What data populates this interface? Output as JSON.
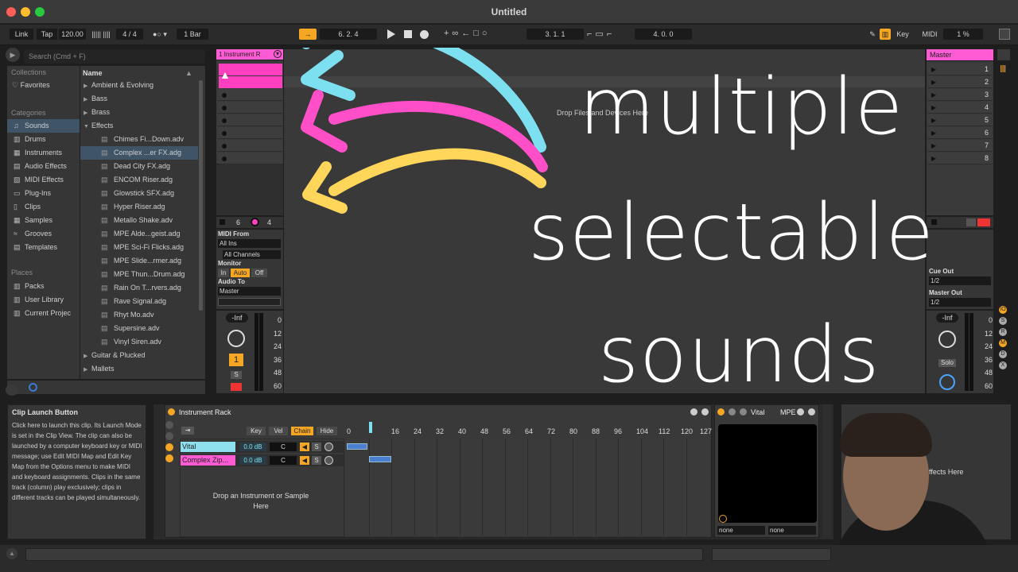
{
  "app": {
    "title": "Untitled"
  },
  "toolbar": {
    "link": "Link",
    "tap": "Tap",
    "tempo": "120.00",
    "meter_bars": "||||| ||||",
    "signature": "4 / 4",
    "quant": "1 Bar",
    "position": "6.   2.   4",
    "loop_start": "3.   1.   1",
    "loop_length": "4.   0.   0",
    "key": "Key",
    "midi": "MIDI",
    "cpu": "1 %"
  },
  "browser": {
    "search_placeholder": "Search (Cmd + F)",
    "collections_label": "Collections",
    "favorites": "Favorites",
    "categories_label": "Categories",
    "categories": [
      "Sounds",
      "Drums",
      "Instruments",
      "Audio Effects",
      "MIDI Effects",
      "Plug-Ins",
      "Clips",
      "Samples",
      "Grooves",
      "Templates"
    ],
    "places_label": "Places",
    "places": [
      "Packs",
      "User Library",
      "Current Projec"
    ],
    "name_header": "Name",
    "folders_top": [
      "Ambient & Evolving",
      "Bass",
      "Brass",
      "Effects"
    ],
    "effects": [
      "Chimes Fi...Down.adv",
      "Complex ...er FX.adg",
      "Dead City FX.adg",
      "ENCOM Riser.adg",
      "Glowstick SFX.adg",
      "Hyper Riser.adg",
      "Metallo Shake.adv",
      "MPE Alde...geist.adg",
      "MPE Sci-Fi Flicks.adg",
      "MPE Slide...rmer.adg",
      "MPE Thun...Drum.adg",
      "Rain On T...rvers.adg",
      "Rave Signal.adg",
      "Rhyt Mo.adv",
      "Supersine.adv",
      "Vinyl Siren.adv"
    ],
    "folders_bottom": [
      "Guitar & Plucked",
      "Mallets"
    ]
  },
  "track": {
    "name": "1 Instrument R",
    "count_left": "6",
    "count_right": "4",
    "midi_from": "MIDI From",
    "midi_from_val": "All Ins",
    "channels": "All Channels",
    "monitor": "Monitor",
    "mon_in": "In",
    "mon_auto": "Auto",
    "mon_off": "Off",
    "audio_to": "Audio To",
    "audio_to_val": "Master",
    "vol": "-Inf",
    "number": "1",
    "solo": "S",
    "meter": [
      "0",
      "12",
      "24",
      "36",
      "48",
      "60"
    ]
  },
  "session": {
    "drop_hint": "Drop Files and Devices Here"
  },
  "master": {
    "name": "Master",
    "scenes": [
      "1",
      "2",
      "3",
      "4",
      "5",
      "6",
      "7",
      "8"
    ],
    "cue_out": "Cue Out",
    "cue_val": "1/2",
    "master_out": "Master Out",
    "master_val": "1/2",
    "vol": "-Inf",
    "solo": "Solo",
    "meter": [
      "0",
      "12",
      "24",
      "36",
      "48",
      "60"
    ]
  },
  "overlay": {
    "line1": "multiple",
    "line2": "selectable",
    "line3": "sounds"
  },
  "info": {
    "title": "Clip Launch Button",
    "body": "Click here to launch this clip. Its Launch Mode is set in the Clip View. The clip can also be launched by a computer keyboard key or MIDI message; use Edit MIDI Map and Edit Key Map from the Options menu to make MIDI and keyboard assignments. Clips in the same track (column) play exclusively; clips in different tracks can be played simultaneously."
  },
  "rack": {
    "title": "Instrument Rack",
    "key": "Key",
    "vel": "Vel",
    "chain": "Chain",
    "hide": "Hide",
    "chains": [
      {
        "name": "Vital",
        "vol": "0.0 dB",
        "pan": "C",
        "s": "S"
      },
      {
        "name": "Complex Zip...",
        "vol": "0.0 dB",
        "pan": "C",
        "s": "S"
      }
    ],
    "drop_hint": "Drop an Instrument or Sample Here",
    "ruler": [
      "0",
      "16",
      "24",
      "32",
      "40",
      "48",
      "56",
      "64",
      "72",
      "80",
      "88",
      "96",
      "104",
      "112",
      "120",
      "127"
    ]
  },
  "vital": {
    "title": "Vital",
    "mpe": "MPE",
    "none1": "none",
    "none2": "none"
  },
  "effects": {
    "drop_hint": "Effects Here"
  },
  "colors": {
    "accent": "#f5a623",
    "pink": "#ff3fbf",
    "cyan": "#7de0f0",
    "selection": "#3f5567"
  }
}
